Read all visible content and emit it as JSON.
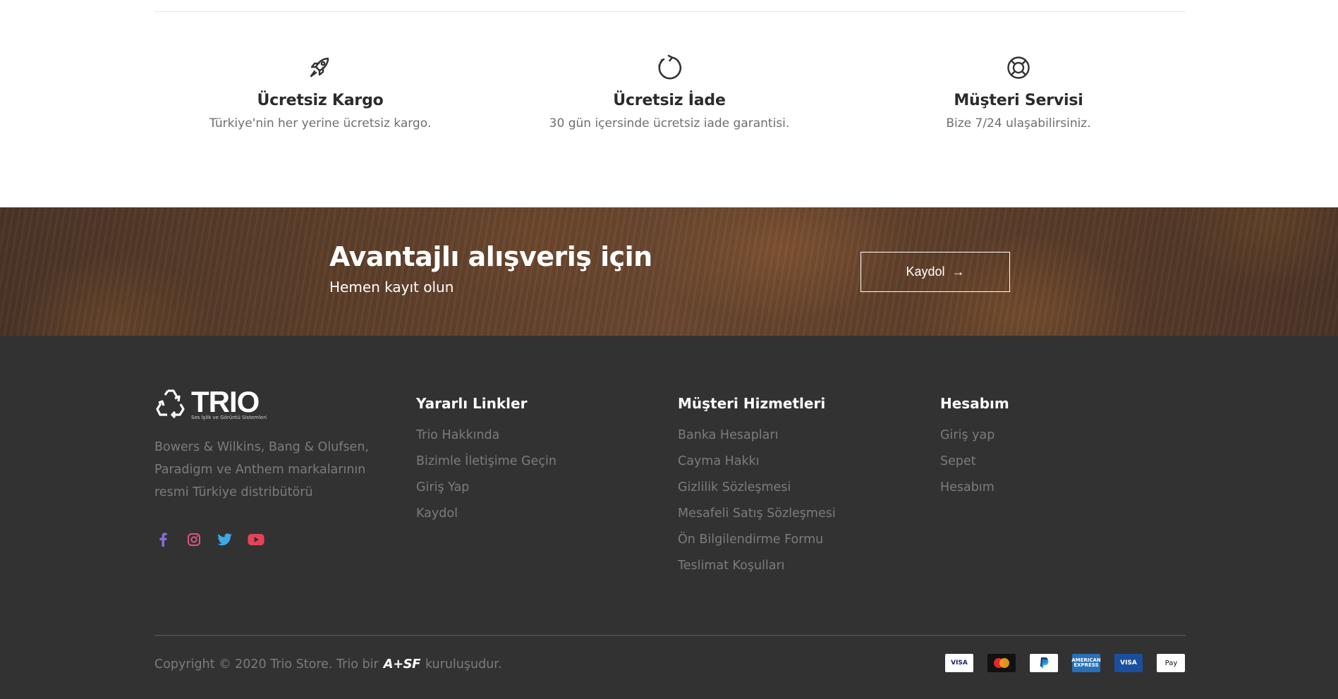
{
  "features": [
    {
      "icon": "rocket-icon",
      "title": "Ücretsiz Kargo",
      "desc": "Türkiye'nin her yerine ücretsiz kargo."
    },
    {
      "icon": "refresh-icon",
      "title": "Ücretsiz İade",
      "desc": "30 gün içersinde ücretsiz iade garantisi."
    },
    {
      "icon": "lifebuoy-icon",
      "title": "Müşteri Servisi",
      "desc": "Bize 7/24 ulaşabilirsiniz."
    }
  ],
  "banner": {
    "title": "Avantajlı alışveriş için",
    "subtitle": "Hemen kayıt olun",
    "button_label": "Kaydol",
    "button_arrow": "→"
  },
  "footer": {
    "logo_text": "TRIO",
    "logo_tagline": "Ses İşlik ve Görüntü Sistemleri",
    "about": "Bowers & Wilkins, Bang & Olufsen, Paradigm ve Anthem markalarının resmi Türkiye distribütörü",
    "socials": [
      "facebook-icon",
      "instagram-icon",
      "twitter-icon",
      "youtube-icon"
    ],
    "columns": [
      {
        "title": "Yararlı Linkler",
        "links": [
          "Trio Hakkında",
          "Bizimle İletişime Geçin",
          "Giriş Yap",
          "Kaydol"
        ]
      },
      {
        "title": "Müşteri Hizmetleri",
        "links": [
          "Banka Hesapları",
          "Cayma Hakkı",
          "Gizlilik Sözleşmesi",
          "Mesafeli Satış Sözleşmesi",
          "Ön Bilgilendirme Formu",
          "Teslimat Koşulları"
        ]
      },
      {
        "title": "Hesabım",
        "links": [
          "Giriş yap",
          "Sepet",
          "Hesabım"
        ]
      }
    ],
    "copyright_prefix": "Copyright © 2020 Trio Store. Trio bir",
    "copyright_brand": "A+SF",
    "copyright_suffix": "kuruluşudur.",
    "payments": [
      {
        "name": "visa-icon",
        "label": "VISA"
      },
      {
        "name": "mastercard-icon",
        "label": ""
      },
      {
        "name": "paypal-icon",
        "label": "PayPal"
      },
      {
        "name": "amex-icon",
        "label": "AMERICAN EXPRESS"
      },
      {
        "name": "visa-electron-icon",
        "label": "VISA"
      },
      {
        "name": "apple-pay-icon",
        "label": "Pay"
      }
    ]
  },
  "colors": {
    "footer_bg": "#323232",
    "footer_text": "#7c7c7c",
    "facebook": "#8b6cd9",
    "instagram": "#e0557f",
    "twitter": "#3fa9e6",
    "youtube": "#e8425a"
  }
}
